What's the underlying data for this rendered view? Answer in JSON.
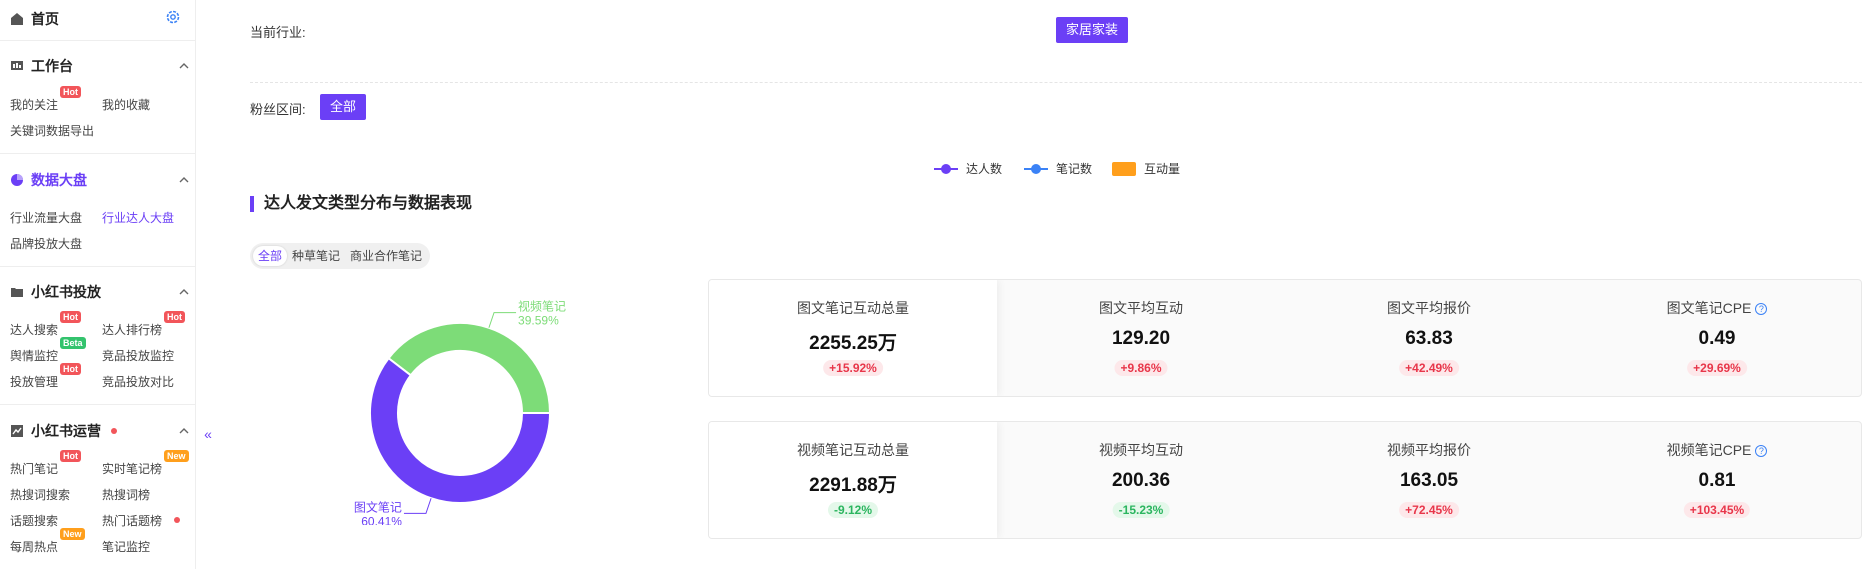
{
  "sidebar": {
    "home": "首页",
    "groups": [
      {
        "title": "工作台",
        "items": [
          {
            "label": "我的关注",
            "badge": "Hot"
          },
          {
            "label": "我的收藏"
          },
          {
            "label": "关键词数据导出"
          }
        ]
      },
      {
        "title": "数据大盘",
        "items": [
          {
            "label": "行业流量大盘"
          },
          {
            "label": "行业达人大盘"
          },
          {
            "label": "品牌投放大盘"
          }
        ]
      },
      {
        "title": "小红书投放",
        "items": [
          {
            "label": "达人搜索",
            "badge": "Hot"
          },
          {
            "label": "达人排行榜",
            "badge": "Hot"
          },
          {
            "label": "舆情监控",
            "badge": "Beta"
          },
          {
            "label": "竞品投放监控"
          },
          {
            "label": "投放管理",
            "badge": "Hot"
          },
          {
            "label": "竞品投放对比"
          }
        ]
      },
      {
        "title": "小红书运营",
        "items": [
          {
            "label": "热门笔记",
            "badge": "Hot"
          },
          {
            "label": "实时笔记榜",
            "badge": "New"
          },
          {
            "label": "热搜词搜索"
          },
          {
            "label": "热搜词榜"
          },
          {
            "label": "话题搜索"
          },
          {
            "label": "热门话题榜"
          },
          {
            "label": "每周热点",
            "badge": "New"
          },
          {
            "label": "笔记监控"
          }
        ]
      }
    ],
    "collapse_icon": "«"
  },
  "filters": {
    "industry_label": "当前行业:",
    "industry_value": "家居家装",
    "fans_label": "粉丝区间:",
    "fans_value": "全部"
  },
  "legend": [
    {
      "name": "达人数",
      "color": "#6b3ff6"
    },
    {
      "name": "笔记数",
      "color": "#3b82f6"
    },
    {
      "name": "互动量",
      "color": "#ff9f1c"
    }
  ],
  "section": {
    "title": "达人发文类型分布与数据表现",
    "tabs": [
      "全部",
      "种草笔记",
      "商业合作笔记"
    ]
  },
  "chart_data": {
    "type": "pie",
    "categories": [
      "视频笔记",
      "图文笔记"
    ],
    "values": [
      39.59,
      60.41
    ],
    "colors": [
      "#7ddc78",
      "#6b3ff6"
    ],
    "labels": [
      "39.59%",
      "60.41%"
    ]
  },
  "cards": [
    [
      {
        "label": "图文笔记互动总量",
        "value": "2255.25万",
        "change": "+15.92%",
        "dir": "up"
      },
      {
        "label": "图文平均互动",
        "value": "129.20",
        "change": "+9.86%",
        "dir": "up"
      },
      {
        "label": "图文平均报价",
        "value": "63.83",
        "change": "+42.49%",
        "dir": "up"
      },
      {
        "label": "图文笔记CPE",
        "value": "0.49",
        "change": "+29.69%",
        "dir": "up",
        "help": "?"
      }
    ],
    [
      {
        "label": "视频笔记互动总量",
        "value": "2291.88万",
        "change": "-9.12%",
        "dir": "down"
      },
      {
        "label": "视频平均互动",
        "value": "200.36",
        "change": "-15.23%",
        "dir": "down"
      },
      {
        "label": "视频平均报价",
        "value": "163.05",
        "change": "+72.45%",
        "dir": "up"
      },
      {
        "label": "视频笔记CPE",
        "value": "0.81",
        "change": "+103.45%",
        "dir": "up",
        "help": "?"
      }
    ]
  ]
}
